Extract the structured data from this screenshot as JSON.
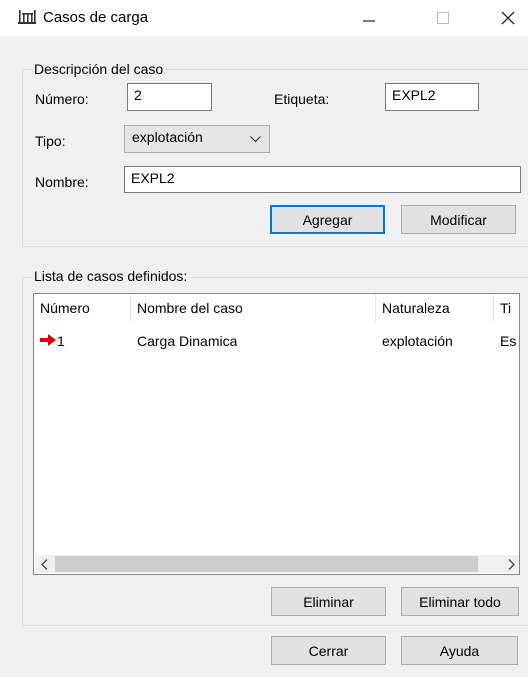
{
  "window": {
    "title": "Casos de carga",
    "icon": "beam-load-icon",
    "controls": [
      "minimize",
      "maximize",
      "close"
    ]
  },
  "case_description": {
    "group_label": "Descripción del caso",
    "number_label": "Número:",
    "number_value": "2",
    "tag_label": "Etiqueta:",
    "tag_value": "EXPL2",
    "type_label": "Tipo:",
    "type_value": "explotación",
    "name_label": "Nombre:",
    "name_value": "EXPL2",
    "add_button": "Agregar",
    "modify_button": "Modificar"
  },
  "case_list": {
    "group_label": "Lista de casos definidos:",
    "columns": [
      "Número",
      "Nombre del caso",
      "Naturaleza",
      "Ti"
    ],
    "rows": [
      {
        "number": "1",
        "name": "Carga Dinamica",
        "nature": "explotación",
        "type": "Es",
        "marker": "red-arrow-icon"
      }
    ],
    "delete_button": "Eliminar",
    "delete_all_button": "Eliminar todo"
  },
  "footer": {
    "close_button": "Cerrar",
    "help_button": "Ayuda"
  },
  "colors": {
    "accent": "#0078d7",
    "marker": "#e00000"
  }
}
